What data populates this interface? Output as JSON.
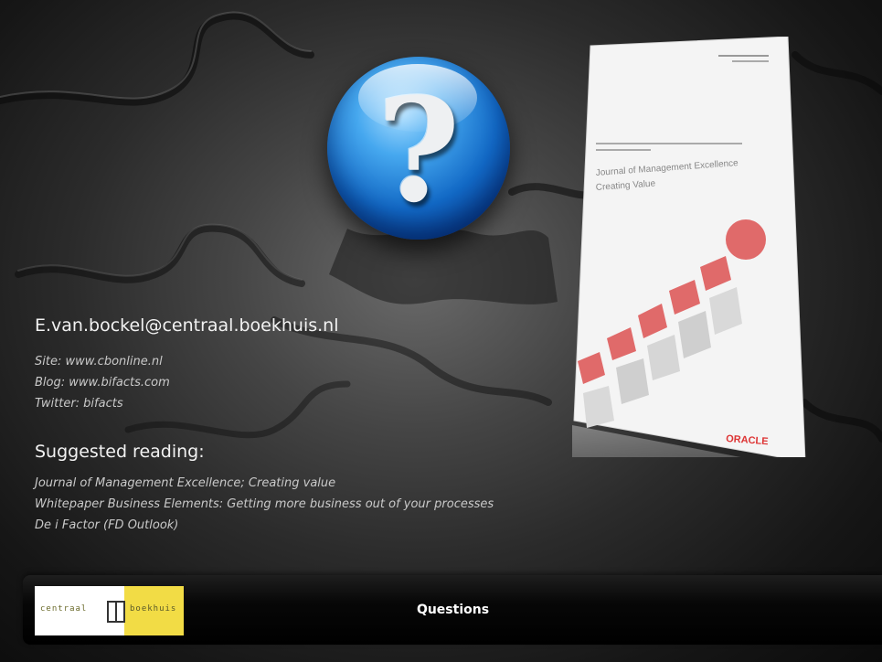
{
  "contact": {
    "email": "E.van.bockel@centraal.boekhuis.nl",
    "info_lines": [
      "Site: www.cbonline.nl",
      "Blog: www.bifacts.com",
      "Twitter: bifacts"
    ]
  },
  "reading": {
    "heading": "Suggested reading:",
    "items": [
      "Journal of Management Excellence; Creating value",
      "Whitepaper Business Elements: Getting more business out of your processes",
      "De i Factor (FD Outlook)"
    ]
  },
  "orb": {
    "symbol": "?",
    "icon": "question-mark-icon"
  },
  "journal": {
    "title_line1": "Journal of Management Excellence",
    "title_line2": "Creating Value",
    "brand": "ORACLE"
  },
  "footer": {
    "title": "Questions",
    "logo_left": "centraal",
    "logo_right": "boekhuis"
  },
  "colors": {
    "orb_blue": "#1269c6",
    "logo_yellow": "#f2dc45",
    "journal_red": "#e06a6a",
    "text_primary": "#f2f2f2",
    "text_secondary": "#c9c9c9"
  }
}
